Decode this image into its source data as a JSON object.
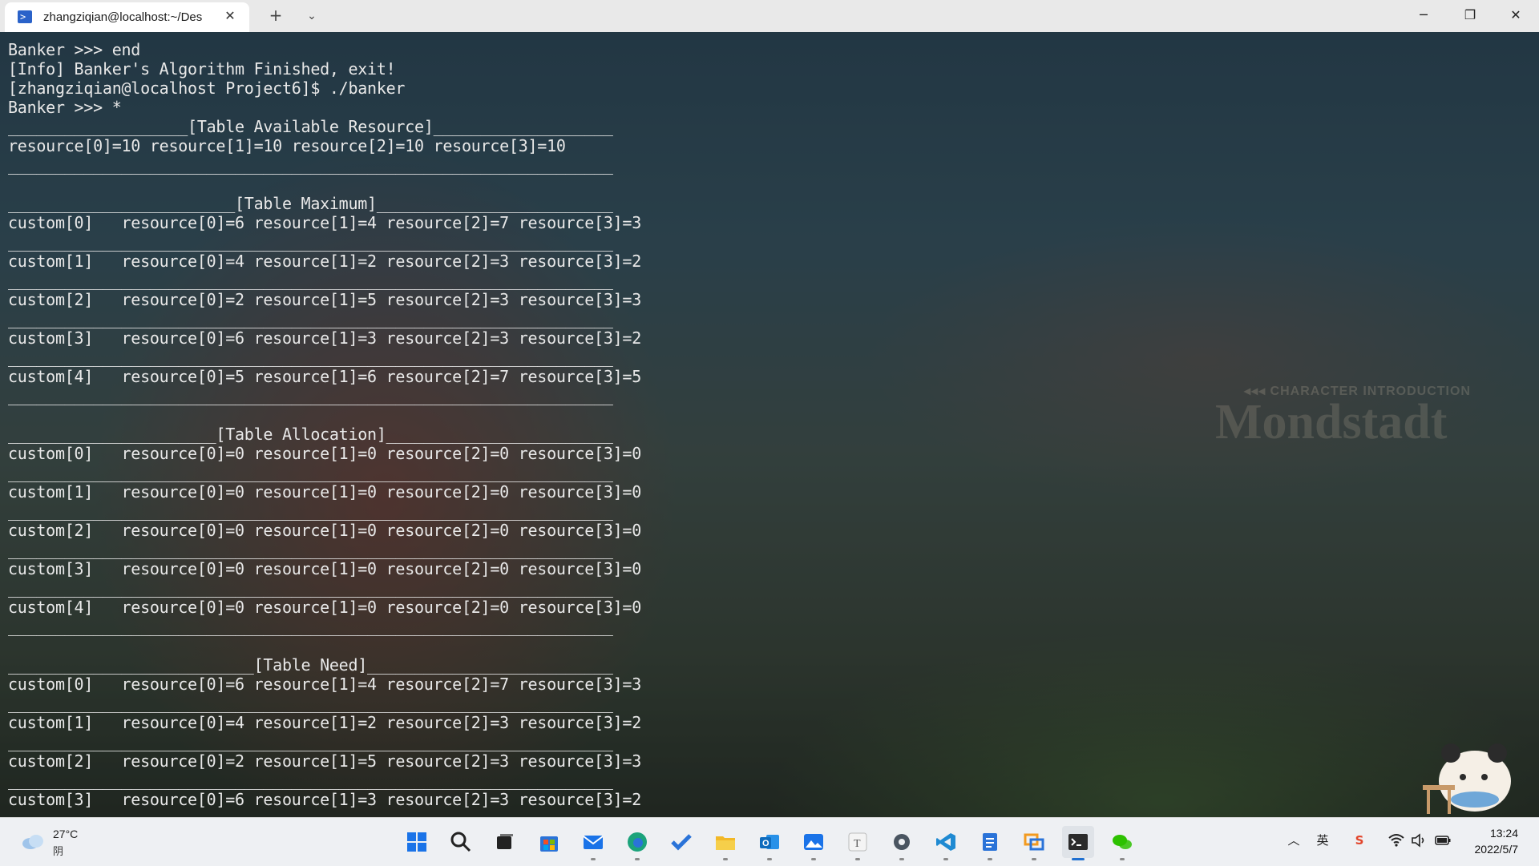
{
  "titlebar": {
    "tab_title": "zhangziqian@localhost:~/Des",
    "tab_icon": "powershell-icon",
    "close_tab_glyph": "✕",
    "new_tab_glyph": "+",
    "dropdown_glyph": "⌄",
    "minimize_glyph": "─",
    "maximize_glyph": "❐",
    "close_glyph": "✕"
  },
  "background": {
    "watermark_small": "◂◂◂ CHARACTER INTRODUCTION",
    "watermark_big": "Mondstadt"
  },
  "terminal": {
    "lines": [
      "Banker >>> end",
      "[Info] Banker's Algorithm Finished, exit!",
      "[zhangziqian@localhost Project6]$ ./banker",
      "Banker >>> *",
      "___________________[Table Available Resource]___________________",
      "resource[0]=10 resource[1]=10 resource[2]=10 resource[3]=10",
      "________________________________________________________________",
      "",
      "________________________[Table Maximum]_________________________",
      "custom[0]   resource[0]=6 resource[1]=4 resource[2]=7 resource[3]=3",
      "________________________________________________________________",
      "custom[1]   resource[0]=4 resource[1]=2 resource[2]=3 resource[3]=2",
      "________________________________________________________________",
      "custom[2]   resource[0]=2 resource[1]=5 resource[2]=3 resource[3]=3",
      "________________________________________________________________",
      "custom[3]   resource[0]=6 resource[1]=3 resource[2]=3 resource[3]=2",
      "________________________________________________________________",
      "custom[4]   resource[0]=5 resource[1]=6 resource[2]=7 resource[3]=5",
      "________________________________________________________________",
      "",
      "______________________[Table Allocation]________________________",
      "custom[0]   resource[0]=0 resource[1]=0 resource[2]=0 resource[3]=0",
      "________________________________________________________________",
      "custom[1]   resource[0]=0 resource[1]=0 resource[2]=0 resource[3]=0",
      "________________________________________________________________",
      "custom[2]   resource[0]=0 resource[1]=0 resource[2]=0 resource[3]=0",
      "________________________________________________________________",
      "custom[3]   resource[0]=0 resource[1]=0 resource[2]=0 resource[3]=0",
      "________________________________________________________________",
      "custom[4]   resource[0]=0 resource[1]=0 resource[2]=0 resource[3]=0",
      "________________________________________________________________",
      "",
      "__________________________[Table Need]__________________________",
      "custom[0]   resource[0]=6 resource[1]=4 resource[2]=7 resource[3]=3",
      "________________________________________________________________",
      "custom[1]   resource[0]=4 resource[1]=2 resource[2]=3 resource[3]=2",
      "________________________________________________________________",
      "custom[2]   resource[0]=2 resource[1]=5 resource[2]=3 resource[3]=3",
      "________________________________________________________________",
      "custom[3]   resource[0]=6 resource[1]=3 resource[2]=3 resource[3]=2"
    ]
  },
  "taskbar": {
    "weather": {
      "temperature": "27°C",
      "condition": "阴",
      "icon": "cloud-icon"
    },
    "apps": [
      {
        "name": "start-icon",
        "color": "#1a73e8"
      },
      {
        "name": "search-icon",
        "color": "#222222"
      },
      {
        "name": "task-view-icon",
        "color": "#222222"
      },
      {
        "name": "microsoft-store-icon",
        "color": "#2a73d8"
      },
      {
        "name": "mail-icon",
        "color": "#1a73e8"
      },
      {
        "name": "edge-icon",
        "color": "#1ba37b"
      },
      {
        "name": "todo-icon",
        "color": "#2a73d8"
      },
      {
        "name": "file-explorer-icon",
        "color": "#f2b827"
      },
      {
        "name": "outlook-icon",
        "color": "#0f6cbd"
      },
      {
        "name": "photos-icon",
        "color": "#1a73e8"
      },
      {
        "name": "typora-icon",
        "color": "#555555"
      },
      {
        "name": "settings-icon",
        "color": "#4a5561"
      },
      {
        "name": "vscode-icon",
        "color": "#1f8ad2"
      },
      {
        "name": "notepad-icon",
        "color": "#2a73d8"
      },
      {
        "name": "remote-desktop-icon",
        "color": "#f29a1f"
      },
      {
        "name": "terminal-icon",
        "color": "#2b2b2b"
      },
      {
        "name": "wechat-icon",
        "color": "#2dc100"
      }
    ],
    "tray": {
      "chevron": "︿",
      "ime": "英",
      "sogou": "S",
      "wifi": "wifi-icon",
      "volume": "volume-icon",
      "battery": "battery-icon"
    },
    "clock": {
      "time": "13:24",
      "date": "2022/5/7"
    }
  }
}
